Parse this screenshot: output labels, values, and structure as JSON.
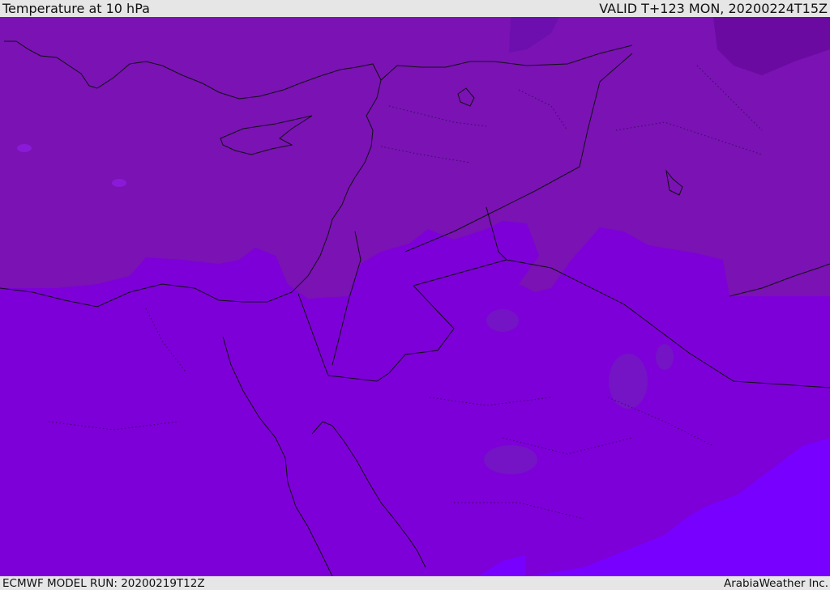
{
  "header": {
    "title": "Temperature at 10 hPa",
    "valid": "VALID T+123 MON, 20200224T15Z"
  },
  "footer": {
    "model_run": "ECMWF MODEL RUN: 20200219T12Z",
    "brand": "ArabiaWeather Inc."
  },
  "colors": {
    "band_north": "#7a12b4",
    "band_mid": "#7d00d8",
    "band_cold": "#6a0aa0",
    "band_warm": "#7800ff",
    "coastline": "#111111"
  }
}
